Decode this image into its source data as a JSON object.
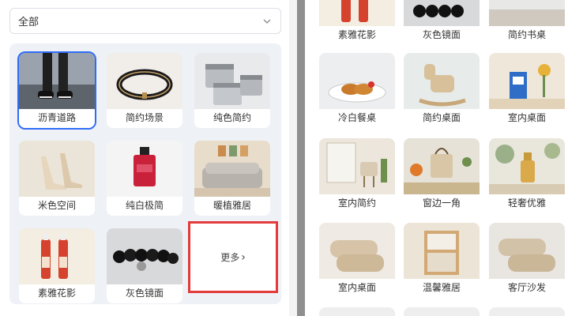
{
  "filter": {
    "selected": "全部"
  },
  "left_grid": {
    "items": [
      {
        "label": "沥青道路",
        "selected": true
      },
      {
        "label": "简约场景",
        "selected": false
      },
      {
        "label": "纯色简约",
        "selected": false
      },
      {
        "label": "米色空间",
        "selected": false
      },
      {
        "label": "纯白极简",
        "selected": false
      },
      {
        "label": "暖植雅居",
        "selected": false
      },
      {
        "label": "素雅花影",
        "selected": false
      },
      {
        "label": "灰色镜面",
        "selected": false
      }
    ],
    "more_label": "更多",
    "more_chevron": "›"
  },
  "right_grid": {
    "rows": [
      [
        "素雅花影",
        "灰色镜面",
        "简约书桌"
      ],
      [
        "冷白餐桌",
        "简约桌面",
        "室内桌面"
      ],
      [
        "室内简约",
        "窗边一角",
        "轻奢优雅"
      ],
      [
        "室内桌面",
        "温馨雅居",
        "客厅沙发"
      ]
    ]
  },
  "colors": {
    "accent": "#2f6cf6",
    "highlight": "#e33b3b"
  }
}
